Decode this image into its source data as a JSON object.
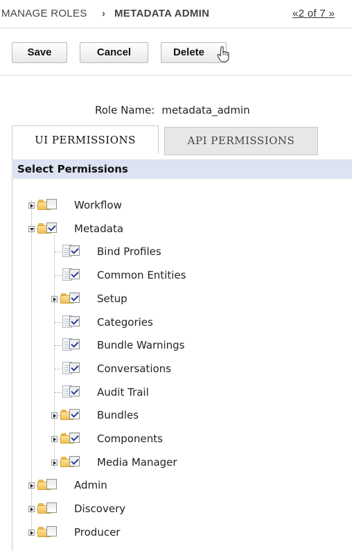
{
  "breadcrumb": {
    "root": "MANAGE ROLES",
    "separator": "›",
    "current": "METADATA  ADMIN",
    "pager": "«2 of 7 »"
  },
  "toolbar": {
    "save_label": "Save",
    "cancel_label": "Cancel",
    "delete_label": "Delete"
  },
  "role": {
    "label": "Role Name:",
    "value": "metadata_admin"
  },
  "tabs": {
    "ui_label": "UI PERMISSIONS",
    "api_label": "API PERMISSIONS",
    "active": "UI PERMISSIONS"
  },
  "panel": {
    "title": "Select Permissions"
  },
  "tree": [
    {
      "label": "Workflow",
      "level": 0,
      "type": "folder",
      "expander": "closed",
      "checked": false
    },
    {
      "label": "Metadata",
      "level": 0,
      "type": "folder",
      "expander": "open",
      "checked": true
    },
    {
      "label": "Bind Profiles",
      "level": 1,
      "type": "doc",
      "expander": "none",
      "checked": true
    },
    {
      "label": "Common Entities",
      "level": 1,
      "type": "doc",
      "expander": "none",
      "checked": true
    },
    {
      "label": "Setup",
      "level": 1,
      "type": "folder",
      "expander": "closed",
      "checked": true
    },
    {
      "label": "Categories",
      "level": 1,
      "type": "doc",
      "expander": "none",
      "checked": true
    },
    {
      "label": "Bundle Warnings",
      "level": 1,
      "type": "doc",
      "expander": "none",
      "checked": true
    },
    {
      "label": "Conversations",
      "level": 1,
      "type": "doc",
      "expander": "none",
      "checked": true
    },
    {
      "label": "Audit Trail",
      "level": 1,
      "type": "doc",
      "expander": "none",
      "checked": true
    },
    {
      "label": "Bundles",
      "level": 1,
      "type": "folder",
      "expander": "closed",
      "checked": true
    },
    {
      "label": "Components",
      "level": 1,
      "type": "folder",
      "expander": "closed",
      "checked": true
    },
    {
      "label": "Media Manager",
      "level": 1,
      "type": "folder",
      "expander": "closed",
      "checked": true
    },
    {
      "label": "Admin",
      "level": 0,
      "type": "folder",
      "expander": "closed",
      "checked": false
    },
    {
      "label": "Discovery",
      "level": 0,
      "type": "folder",
      "expander": "closed",
      "checked": false
    },
    {
      "label": "Producer",
      "level": 0,
      "type": "folder",
      "expander": "closed",
      "checked": false
    }
  ],
  "colors": {
    "panel_header_bg": "#dde3f2",
    "folder": "#f0c050",
    "checkmark": "#2a3f9a"
  }
}
